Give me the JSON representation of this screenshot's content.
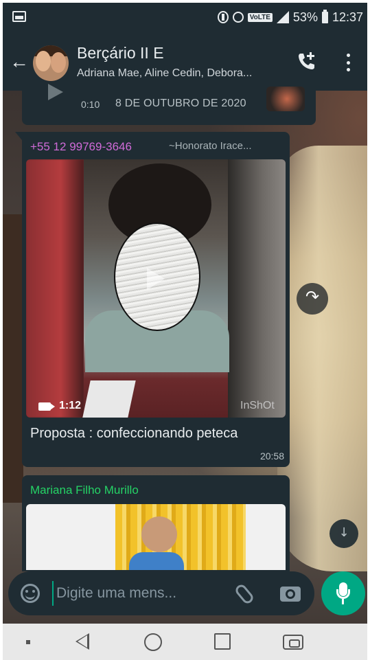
{
  "status_bar": {
    "volte": "VoLTE",
    "battery": "53%",
    "time": "12:37"
  },
  "header": {
    "title": "Berçário II E",
    "members": "Adriana Mae, Aline Cedin, Debora..."
  },
  "messages": {
    "previous": {
      "duration": "0:10",
      "date": "8 DE OUTUBRO DE 2020"
    },
    "video_message": {
      "sender_phone": "+55 12 99769-3646",
      "sender_name": "~Honorato Irace...",
      "video_length": "1:12",
      "watermark": "InShOt",
      "caption": "Proposta : confeccionando peteca",
      "time": "20:58"
    },
    "image_message": {
      "sender": "Mariana Filho Murillo"
    }
  },
  "input": {
    "placeholder": "Digite uma mens..."
  },
  "colors": {
    "header_bg": "#1f2c33",
    "accent_green": "#00a884",
    "sender_pink": "#d06bd8",
    "sender_green": "#25d366"
  }
}
